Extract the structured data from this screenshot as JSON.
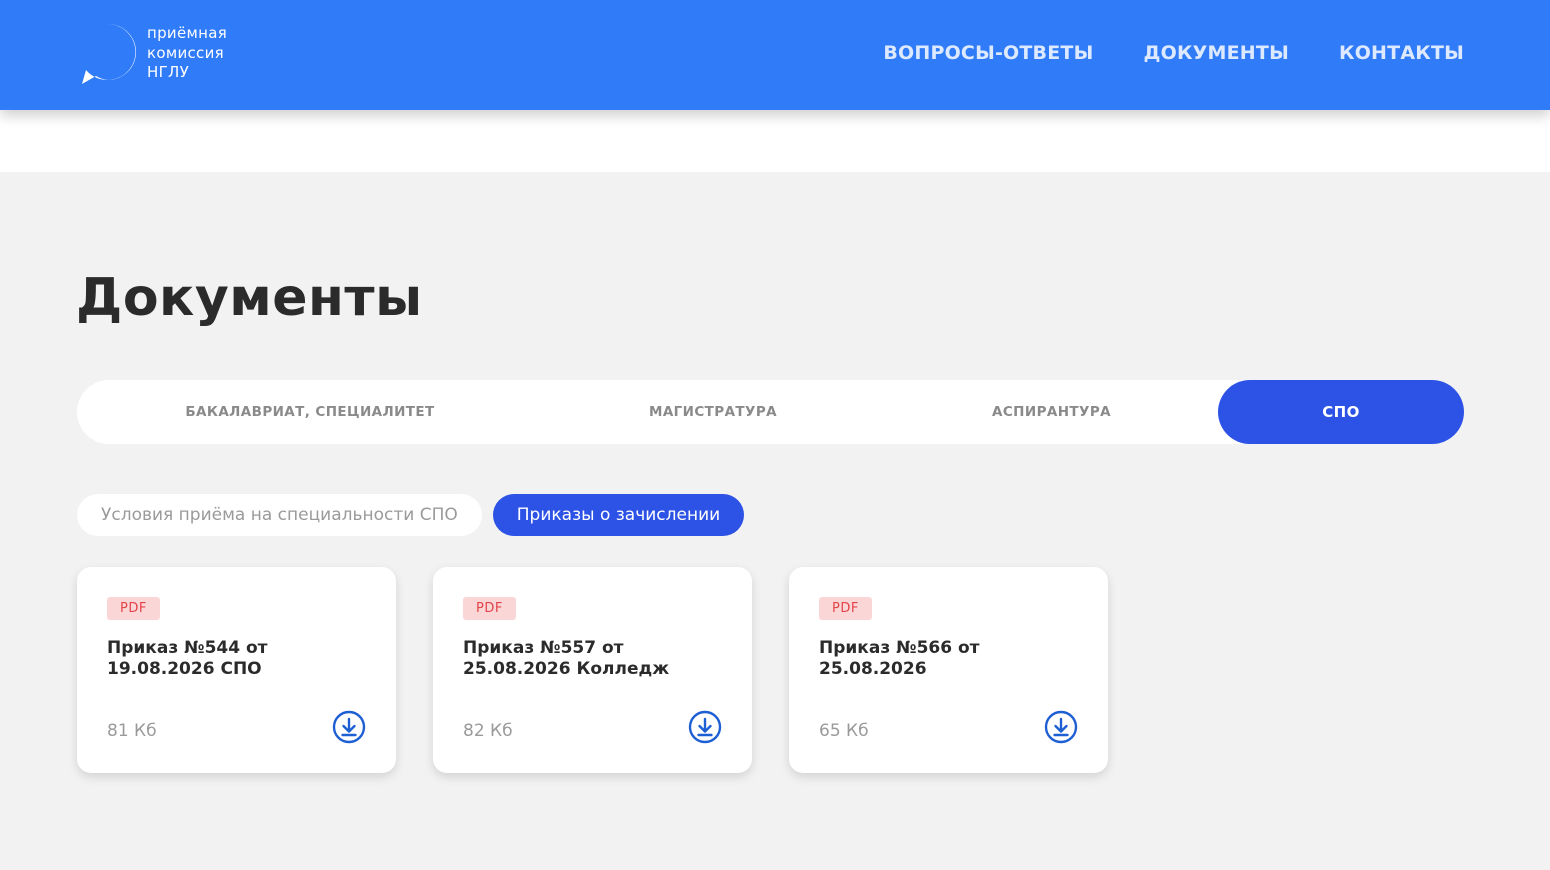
{
  "header": {
    "logo_lines": [
      "приёмная",
      "комиссия",
      "НГЛУ"
    ],
    "logo_icon": "globe-chat-icon",
    "nav": [
      "Вопросы-ответы",
      "Документы",
      "Контакты"
    ]
  },
  "page": {
    "title": "Документы"
  },
  "main_tabs": [
    {
      "label": "Бакалавриат, специалитет",
      "active": false
    },
    {
      "label": "Магистратура",
      "active": false
    },
    {
      "label": "Аспирантура",
      "active": false
    },
    {
      "label": "СПО",
      "active": true
    }
  ],
  "sub_tabs": [
    {
      "label": "Условия приёма на специальности СПО",
      "active": false
    },
    {
      "label": "Приказы о зачислении",
      "active": true
    }
  ],
  "documents": [
    {
      "badge": "PDF",
      "title": "Приказ №544 от 19.08.2026 СПО",
      "size": "81 Кб"
    },
    {
      "badge": "PDF",
      "title": "Приказ №557 от 25.08.2026 Колледж",
      "size": "82 Кб"
    },
    {
      "badge": "PDF",
      "title": "Приказ №566 от 25.08.2026",
      "size": "65 Кб"
    }
  ],
  "colors": {
    "header_blue": "#2f7bf8",
    "active_tab_blue": "#2d52e6",
    "badge_bg": "#fbd6d6",
    "badge_text": "#e0444a",
    "download_icon": "#1f5fd4"
  }
}
